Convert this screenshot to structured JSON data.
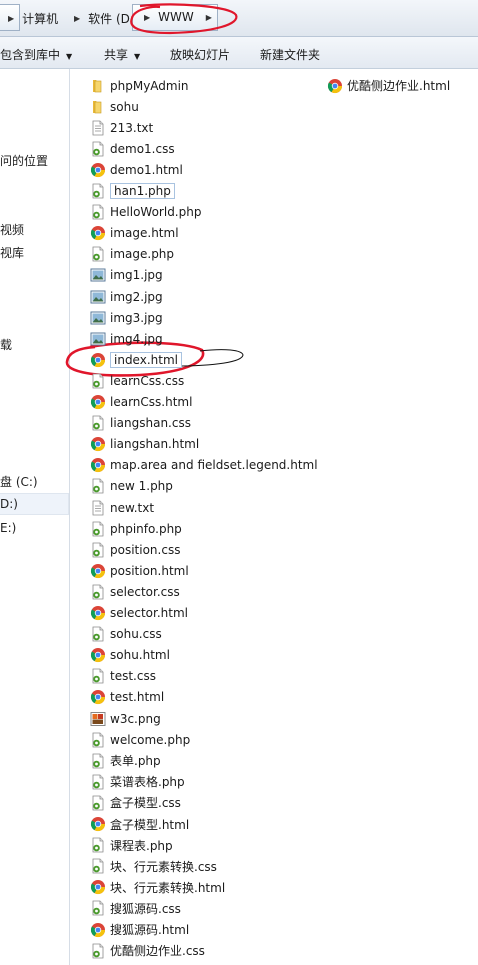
{
  "breadcrumb": [
    "计算机",
    "软件 (D:)",
    "WWW"
  ],
  "toolbar": {
    "include_in_library": "包含到库中",
    "share": "共享",
    "slideshow": "放映幻灯片",
    "new_folder": "新建文件夹"
  },
  "nav": {
    "recent_places": "问的位置",
    "videos": "视频",
    "media_lib": "视库",
    "downloads": "载",
    "drive_c": "盘 (C:)",
    "drive_d": "D:)",
    "drive_e": "E:)"
  },
  "files": [
    {
      "name": "phpMyAdmin",
      "type": "folder"
    },
    {
      "name": "sohu",
      "type": "folder"
    },
    {
      "name": "213.txt",
      "type": "txt"
    },
    {
      "name": "demo1.css",
      "type": "css"
    },
    {
      "name": "demo1.html",
      "type": "html"
    },
    {
      "name": "han1.php",
      "type": "php"
    },
    {
      "name": "HelloWorld.php",
      "type": "php"
    },
    {
      "name": "image.html",
      "type": "html"
    },
    {
      "name": "image.php",
      "type": "php"
    },
    {
      "name": "img1.jpg",
      "type": "img"
    },
    {
      "name": "img2.jpg",
      "type": "img"
    },
    {
      "name": "img3.jpg",
      "type": "img"
    },
    {
      "name": "img4.jpg",
      "type": "img"
    },
    {
      "name": "index.html",
      "type": "html"
    },
    {
      "name": "learnCss.css",
      "type": "css"
    },
    {
      "name": "learnCss.html",
      "type": "html"
    },
    {
      "name": "liangshan.css",
      "type": "css"
    },
    {
      "name": "liangshan.html",
      "type": "html"
    },
    {
      "name": "map.area and fieldset.legend.html",
      "type": "html"
    },
    {
      "name": "new 1.php",
      "type": "php"
    },
    {
      "name": "new.txt",
      "type": "txt"
    },
    {
      "name": "phpinfo.php",
      "type": "php"
    },
    {
      "name": "position.css",
      "type": "css"
    },
    {
      "name": "position.html",
      "type": "html"
    },
    {
      "name": "selector.css",
      "type": "css"
    },
    {
      "name": "selector.html",
      "type": "html"
    },
    {
      "name": "sohu.css",
      "type": "css"
    },
    {
      "name": "sohu.html",
      "type": "html"
    },
    {
      "name": "test.css",
      "type": "css"
    },
    {
      "name": "test.html",
      "type": "html"
    },
    {
      "name": "w3c.png",
      "type": "png"
    },
    {
      "name": "welcome.php",
      "type": "php"
    },
    {
      "name": "表单.php",
      "type": "php"
    },
    {
      "name": "菜谱表格.php",
      "type": "php"
    },
    {
      "name": "盒子模型.css",
      "type": "css"
    },
    {
      "name": "盒子模型.html",
      "type": "html"
    },
    {
      "name": "课程表.php",
      "type": "php"
    },
    {
      "name": "块、行元素转换.css",
      "type": "css"
    },
    {
      "name": "块、行元素转换.html",
      "type": "html"
    },
    {
      "name": "搜狐源码.css",
      "type": "css"
    },
    {
      "name": "搜狐源码.html",
      "type": "html"
    },
    {
      "name": "优酷侧边作业.css",
      "type": "css"
    }
  ],
  "files_col2": [
    {
      "name": "优酷侧边作业.html",
      "type": "html"
    }
  ],
  "colors": {
    "annotation_red": "#e0162b",
    "folder_yellow": "#f3c843",
    "php_green": "#4a9a2c"
  }
}
